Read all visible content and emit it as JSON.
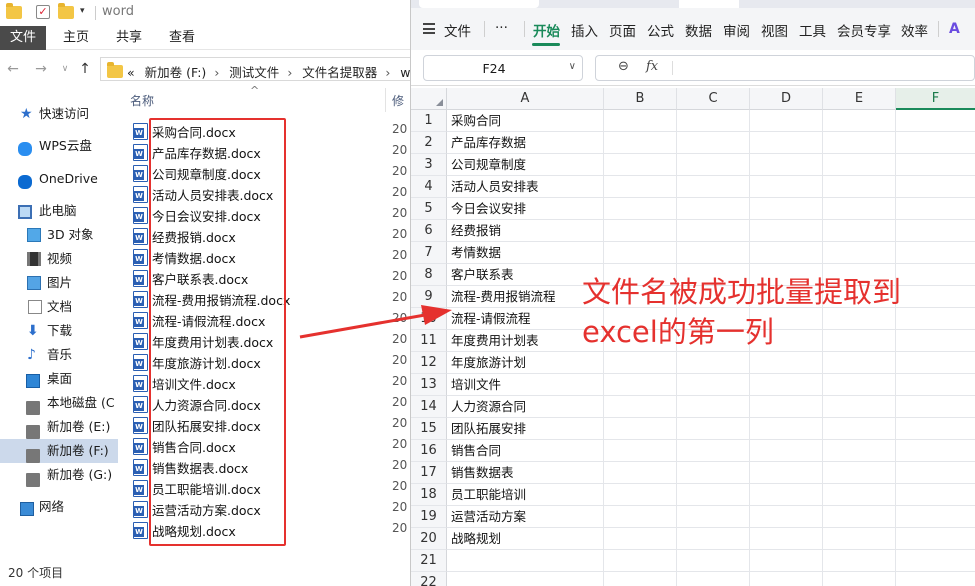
{
  "explorer": {
    "window_title": "word",
    "ribbon_tabs": [
      "文件",
      "主页",
      "共享",
      "查看"
    ],
    "breadcrumb": [
      "«",
      "新加卷 (F:)",
      "测试文件",
      "文件名提取器",
      "wo"
    ],
    "nav_items": [
      "快速访问",
      "WPS云盘",
      "OneDrive",
      "此电脑",
      "3D 对象",
      "视频",
      "图片",
      "文档",
      "下载",
      "音乐",
      "桌面",
      "本地磁盘 (C",
      "新加卷 (E:)",
      "新加卷 (F:)",
      "新加卷 (G:)",
      "网络"
    ],
    "column_name": "名称",
    "column_modified": "修",
    "files": [
      "采购合同.docx",
      "产品库存数据.docx",
      "公司规章制度.docx",
      "活动人员安排表.docx",
      "今日会议安排.docx",
      "经费报销.docx",
      "考情数据.docx",
      "客户联系表.docx",
      "流程-费用报销流程.docx",
      "流程-请假流程.docx",
      "年度费用计划表.docx",
      "年度旅游计划.docx",
      "培训文件.docx",
      "人力资源合同.docx",
      "团队拓展安排.docx",
      "销售合同.docx",
      "销售数据表.docx",
      "员工职能培训.docx",
      "运营活动方案.docx",
      "战略规划.docx"
    ],
    "date_prefix": "20",
    "status": "20 个项目"
  },
  "sheet": {
    "menu": [
      "文件",
      "···",
      "开始",
      "插入",
      "页面",
      "公式",
      "数据",
      "审阅",
      "视图",
      "工具",
      "会员专享",
      "效率"
    ],
    "active_menu": "开始",
    "name_box": "F24",
    "fx_label": "fx",
    "columns": [
      "A",
      "B",
      "C",
      "D",
      "E",
      "F"
    ],
    "selected_column": "F",
    "rows": [
      "1",
      "2",
      "3",
      "4",
      "5",
      "6",
      "7",
      "8",
      "9",
      "10",
      "11",
      "12",
      "13",
      "14",
      "15",
      "16",
      "17",
      "18",
      "19",
      "20",
      "21",
      "22"
    ],
    "column_a": [
      "采购合同",
      "产品库存数据",
      "公司规章制度",
      "活动人员安排表",
      "今日会议安排",
      "经费报销",
      "考情数据",
      "客户联系表",
      "流程-费用报销流程",
      "流程-请假流程",
      "年度费用计划表",
      "年度旅游计划",
      "培训文件",
      "人力资源合同",
      "团队拓展安排",
      "销售合同",
      "销售数据表",
      "员工职能培训",
      "运营活动方案",
      "战略规划",
      "",
      ""
    ]
  },
  "annotation": {
    "line1": "文件名被成功批量提取到",
    "line2": "excel的第一列",
    "color": "#e5312e"
  }
}
